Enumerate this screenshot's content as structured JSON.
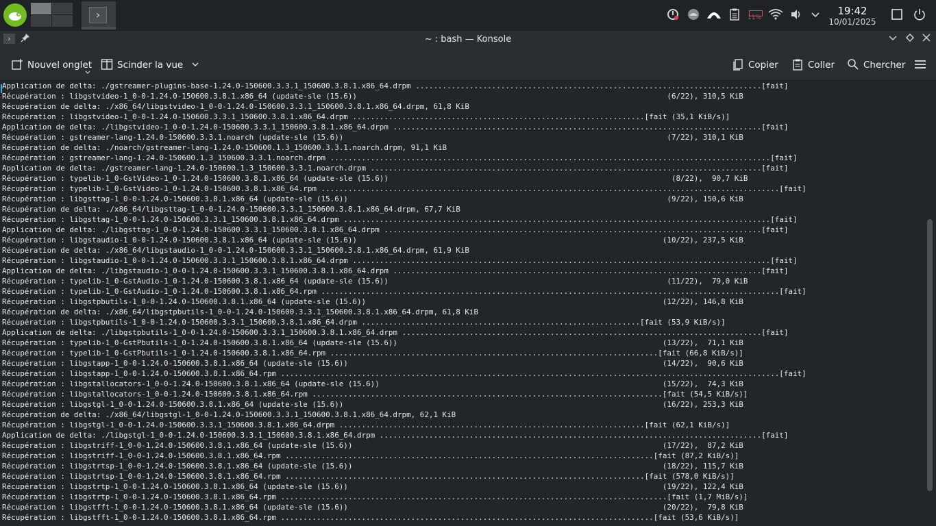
{
  "panel": {
    "pager": {
      "current": 1,
      "count": 4
    },
    "task_icon": "terminal-icon",
    "tray": [
      "updates-icon",
      "disk-icon",
      "network-bar-icon",
      "clipboard-icon",
      "battery-icon",
      "wifi-icon",
      "volume-icon",
      "chevron-down-icon"
    ],
    "battery_percent": "11%",
    "clock": {
      "time": "19:42",
      "date": "10/01/2025"
    },
    "show_desktop_icon": "show-desktop-icon",
    "power_icon": "power-icon"
  },
  "window": {
    "title": "~ : bash — Konsole"
  },
  "toolbar": {
    "new_tab": "Nouvel onglet",
    "split_view": "Scinder la vue",
    "copy": "Copier",
    "paste": "Coller",
    "search": "Chercher"
  },
  "terminal": {
    "lines": [
      "Application de delta: ./gstreamer-plugins-base-1.24.0-150600.3.3.1_150600.3.8.1.x86_64.drpm .............................................................................[fait]",
      "Récupération : libgstvideo-1_0-0-1.24.0-150600.3.8.1.x86_64 (update-sle (15.6))                                                                     (6/22), 310,5 KiB",
      "Récupération de delta: ./x86_64/libgstvideo-1_0-0-1.24.0-150600.3.3.1_150600.3.8.1.x86_64.drpm, 61,8 KiB",
      "Récupération : libgstvideo-1_0-0-1.24.0-150600.3.3.1_150600.3.8.1.x86_64.drpm .................................................................[fait (35,1 KiB/s)]",
      "Application de delta: ./libgstvideo-1_0-0-1.24.0-150600.3.3.1_150600.3.8.1.x86_64.drpm ..................................................................................[fait]",
      "Récupération : gstreamer-lang-1.24.0-150600.3.3.1.noarch (update-sle (15.6))                                                                        (7/22), 310,1 KiB",
      "Récupération de delta: ./noarch/gstreamer-lang-1.24.0-150600.1.3_150600.3.3.1.noarch.drpm, 91,1 KiB",
      "Récupération : gstreamer-lang-1.24.0-150600.1.3_150600.3.3.1.noarch.drpm ..................................................................................................[fait]",
      "Application de delta: ./gstreamer-lang-1.24.0-150600.1.3_150600.3.3.1.noarch.drpm .......................................................................................[fait]",
      "Récupération : typelib-1_0-GstVideo-1_0-1.24.0-150600.3.8.1.x86_64 (update-sle (15.6))                                                               (8/22),  90,7 KiB",
      "Récupération : typelib-1_0-GstVideo-1_0-1.24.0-150600.3.8.1.x86_64.rpm ......................................................................................................[fait]",
      "Récupération : libgsttag-1_0-0-1.24.0-150600.3.8.1.x86_64 (update-sle (15.6))                                                                       (9/22), 150,6 KiB",
      "Récupération de delta: ./x86_64/libgsttag-1_0-0-1.24.0-150600.3.3.1_150600.3.8.1.x86_64.drpm, 67,7 KiB",
      "Récupération : libgsttag-1_0-0-1.24.0-150600.3.3.1_150600.3.8.1.x86_64.drpm ...............................................................................................[fait]",
      "Application de delta: ./libgsttag-1_0-0-1.24.0-150600.3.3.1_150600.3.8.1.x86_64.drpm ....................................................................................[fait]",
      "Récupération : libgstaudio-1_0-0-1.24.0-150600.3.8.1.x86_64 (update-sle (15.6))                                                                    (10/22), 237,5 KiB",
      "Récupération de delta: ./x86_64/libgstaudio-1_0-0-1.24.0-150600.3.3.1_150600.3.8.1.x86_64.drpm, 61,9 KiB",
      "Récupération : libgstaudio-1_0-0-1.24.0-150600.3.3.1_150600.3.8.1.x86_64.drpm .............................................................................................[fait]",
      "Application de delta: ./libgstaudio-1_0-0-1.24.0-150600.3.3.1_150600.3.8.1.x86_64.drpm ..................................................................................[fait]",
      "Récupération : typelib-1_0-GstAudio-1_0-1.24.0-150600.3.8.1.x86_64 (update-sle (15.6))                                                              (11/22),  79,0 KiB",
      "Récupération : typelib-1_0-GstAudio-1_0-1.24.0-150600.3.8.1.x86_64.rpm ......................................................................................................[fait]",
      "Récupération : libgstpbutils-1_0-0-1.24.0-150600.3.8.1.x86_64 (update-sle (15.6))                                                                  (12/22), 146,8 KiB",
      "Récupération de delta: ./x86_64/libgstpbutils-1_0-0-1.24.0-150600.3.3.1_150600.3.8.1.x86_64.drpm, 61,8 KiB",
      "Récupération : libgstpbutils-1_0-0-1.24.0-150600.3.3.1_150600.3.8.1.x86_64.drpm ..............................................................[fait (53,9 KiB/s)]",
      "Application de delta: ./libgstpbutils-1_0-0-1.24.0-150600.3.3.1_150600.3.8.1.x86_64.drpm ................................................................................[fait]",
      "Récupération : typelib-1_0-GstPbutils-1_0-1.24.0-150600.3.8.1.x86_64 (update-sle (15.6))                                                           (13/22),  71,1 KiB",
      "Récupération : typelib-1_0-GstPbutils-1_0-1.24.0-150600.3.8.1.x86_64.rpm .........................................................................[fait (66,8 KiB/s)]",
      "Récupération : libgstapp-1_0-0-1.24.0-150600.3.8.1.x86_64 (update-sle (15.6))                                                                      (14/22),  90,6 KiB",
      "Récupération : libgstapp-1_0-0-1.24.0-150600.3.8.1.x86_64.rpm ...............................................................................................................[fait]",
      "Récupération : libgstallocators-1_0-0-1.24.0-150600.3.8.1.x86_64 (update-sle (15.6))                                                               (15/22),  74,3 KiB",
      "Récupération : libgstallocators-1_0-0-1.24.0-150600.3.8.1.x86_64.rpm ..............................................................................[fait (54,5 KiB/s)]",
      "Récupération : libgstgl-1_0-0-1.24.0-150600.3.8.1.x86_64 (update-sle (15.6))                                                                       (16/22), 253,3 KiB",
      "Récupération de delta: ./x86_64/libgstgl-1_0-0-1.24.0-150600.3.3.1_150600.3.8.1.x86_64.drpm, 62,1 KiB",
      "Récupération : libgstgl-1_0-0-1.24.0-150600.3.3.1_150600.3.8.1.x86_64.drpm ....................................................................[fait (62,1 KiB/s)]",
      "Application de delta: ./libgstgl-1_0-0-1.24.0-150600.3.3.1_150600.3.8.1.x86_64.drpm .....................................................................................[fait]",
      "Récupération : libgstriff-1_0-0-1.24.0-150600.3.8.1.x86_64 (update-sle (15.6))                                                                     (17/22),  87,2 KiB",
      "Récupération : libgstriff-1_0-0-1.24.0-150600.3.8.1.x86_64.rpm ..................................................................................[fait (87,2 KiB/s)]",
      "Récupération : libgstrtsp-1_0-0-1.24.0-150600.3.8.1.x86_64 (update-sle (15.6))                                                                     (18/22), 115,7 KiB",
      "Récupération : libgstrtsp-1_0-0-1.24.0-150600.3.8.1.x86_64.rpm ................................................................................[fait (578,0 KiB/s)]",
      "Récupération : libgstrtp-1_0-0-1.24.0-150600.3.8.1.x86_64 (update-sle (15.6))                                                                      (19/22), 122,4 KiB",
      "Récupération : libgstrtp-1_0-0-1.24.0-150600.3.8.1.x86_64.rpm ......................................................................................[fait (1,7 MiB/s)]",
      "Récupération : libgstfft-1_0-0-1.24.0-150600.3.8.1.x86_64 (update-sle (15.6))                                                                      (20/22),  79,8 KiB",
      "Récupération : libgstfft-1_0-0-1.24.0-150600.3.8.1.x86_64.rpm ...................................................................................[fait (53,6 KiB/s)]"
    ]
  },
  "scrollbar": {
    "position": 0.31,
    "visible_fraction": 0.61
  }
}
